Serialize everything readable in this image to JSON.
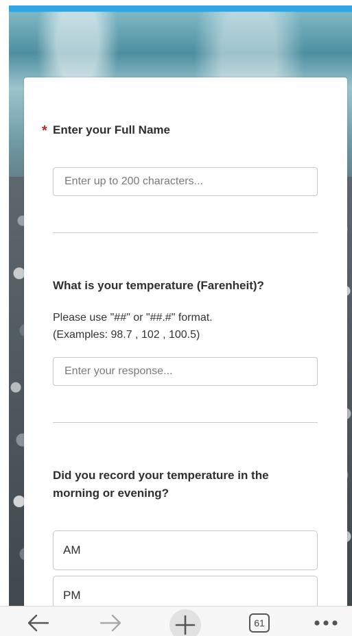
{
  "form": {
    "q1": {
      "required_mark": "*",
      "title": "Enter your Full Name",
      "placeholder": "Enter up to 200 characters..."
    },
    "q2": {
      "title": "What is your temperature (Farenheit)?",
      "desc_line1": "Please use \"##\" or \"##.#\" format.",
      "desc_line2": "(Examples: 98.7 , 102 , 100.5)",
      "placeholder": "Enter your response..."
    },
    "q3": {
      "title": "Did you record your temperature in the morning or evening?",
      "options": [
        "AM",
        "PM"
      ]
    }
  },
  "toolbar": {
    "tab_count": "61",
    "icons": {
      "back": "arrow-left-icon",
      "forward": "arrow-right-icon",
      "new_tab": "plus-icon",
      "tabs": "tabs-icon",
      "menu": "more-dots-icon"
    }
  },
  "colors": {
    "top_accent": "#2fa7e6",
    "required": "#c0282d"
  }
}
